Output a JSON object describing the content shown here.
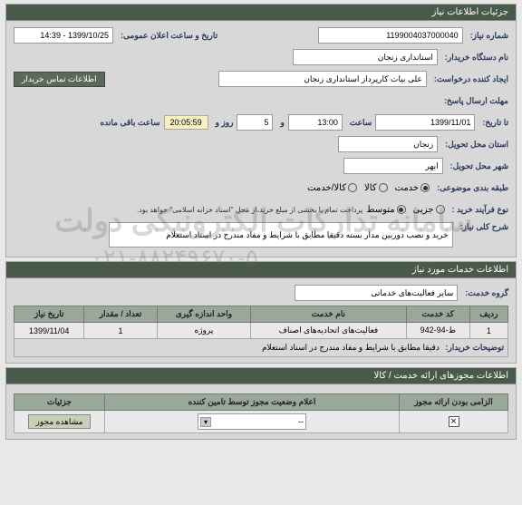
{
  "watermark": {
    "line1": "سامانه تدارکات الکترونیکی دولت",
    "line2": "۰۲۱-۸۸۲۴۹۶۷۰-۵"
  },
  "panels": {
    "need": {
      "title": "جزئیات اطلاعات نیاز",
      "labels": {
        "need_no": "شماره نیاز:",
        "buyer_org": "نام دستگاه خریدار:",
        "creator": "ایجاد کننده درخواست:",
        "deadline": "مهلت ارسال پاسخ:",
        "to_date": "تا تاریخ:",
        "delivery_province": "استان محل تحویل:",
        "delivery_city": "شهر محل تحویل:",
        "subject_cat": "طبقه بندی موضوعی:",
        "purchase_type": "نوع فرآیند خرید :",
        "general_desc": "شرح کلی نیاز:",
        "announce_datetime": "تاریخ و ساعت اعلان عمومی:",
        "hour": "ساعت",
        "and": "و",
        "day": "روز و",
        "remaining": "ساعت باقی مانده",
        "contact_btn": "اطلاعات تماس خریدار"
      },
      "values": {
        "need_no": "1199004037000040",
        "buyer_org": "استانداری زنجان",
        "creator": "علی بیات کارپرداز  استانداری زنجان",
        "announce_datetime": "1399/10/25 - 14:39",
        "deadline_date": "1399/11/01",
        "deadline_time": "13:00",
        "days_remaining": "5",
        "time_remaining": "20:05:59",
        "province": "زنجان",
        "city": "ابهر",
        "general_desc": "خرید و نصب دوربین مدار بسته دقیقا مطابق با شرایط و مفاد مندرج در اسناد استعلام"
      },
      "subject_options": {
        "service": "خدمت",
        "goods": "کالا",
        "both": "کالا/خدمت"
      },
      "purchase_options": {
        "small": "جزیی",
        "medium": "متوسط"
      },
      "purchase_note": "پرداخت تمام یا بخشی از مبلغ خرید،از محل \"اسناد خزانه اسلامی\" خواهد بود."
    },
    "services": {
      "title": "اطلاعات خدمات مورد نیاز",
      "labels": {
        "service_group": "گروه خدمت:",
        "buyer_notes": "توضیحات خریدار:"
      },
      "values": {
        "service_group": "سایر فعالیت‌های خدماتی",
        "buyer_notes": "دقیقا مطابق با شرایط و مفاد مندرج در اسناد استعلام"
      },
      "table": {
        "headers": {
          "row": "ردیف",
          "code": "کد خدمت",
          "name": "نام خدمت",
          "unit": "واحد اندازه گیری",
          "qty": "تعداد / مقدار",
          "need_date": "تاریخ نیاز"
        },
        "rows": [
          {
            "row": "1",
            "code": "ط-94-942",
            "name": "فعالیت‌های اتحادیه‌های اصناف",
            "unit": "پروژه",
            "qty": "1",
            "need_date": "1399/11/04"
          }
        ]
      }
    },
    "permits": {
      "title": "اطلاعات مجوزهای ارائه خدمت / کالا",
      "table": {
        "headers": {
          "mandatory": "الزامی بودن ارائه مجوز",
          "status": "اعلام وضعیت مجوز توسط تامین کننده",
          "details": "جزئیات"
        },
        "status_placeholder": "--",
        "view_btn": "مشاهده مجوز"
      }
    }
  }
}
